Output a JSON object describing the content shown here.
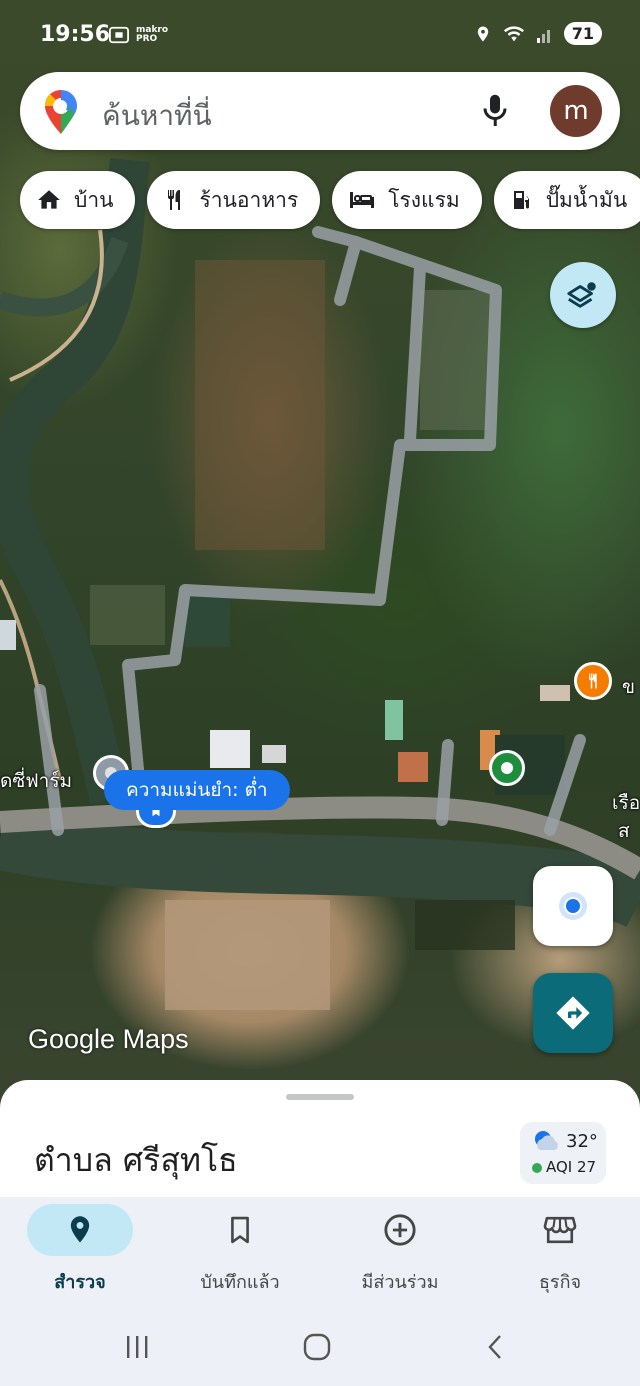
{
  "status_bar": {
    "time": "19:56",
    "notification_icons": [
      "screenshot-icon",
      "makro-pro-icon"
    ],
    "notif_text": "makro PRO",
    "battery": "71"
  },
  "search": {
    "placeholder": "ค้นหาที่นี่",
    "avatar_letter": "m"
  },
  "chips": [
    {
      "label": "บ้าน",
      "icon": "home-icon"
    },
    {
      "label": "ร้านอาหาร",
      "icon": "restaurant-icon"
    },
    {
      "label": "โรงแรม",
      "icon": "hotel-icon"
    },
    {
      "label": "ปั๊มน้ำมัน",
      "icon": "gas-station-icon"
    }
  ],
  "map": {
    "accuracy_label": "ความแม่นยำ: ต่ำ",
    "place_label_left": "ดซี่ฟาร์ม",
    "place_label_right_1": "ข",
    "place_label_right_2": "เรือ",
    "place_label_right_3": "ส",
    "watermark": "Google Maps",
    "colors": {
      "restaurant_pin": "#f57c00",
      "green_pin": "#1e8e3e",
      "route": "#9aa0a6",
      "accuracy_blue": "#1a73e8"
    }
  },
  "sheet": {
    "title": "ตำบล ศรีสุทโธ",
    "temperature": "32°",
    "aqi": "AQI 27"
  },
  "nav": {
    "items": [
      {
        "label": "สำรวจ",
        "icon": "explore-pin-icon",
        "active": true
      },
      {
        "label": "บันทึกแล้ว",
        "icon": "bookmark-icon",
        "active": false
      },
      {
        "label": "มีส่วนร่วม",
        "icon": "add-circle-icon",
        "active": false
      },
      {
        "label": "ธุรกิจ",
        "icon": "storefront-icon",
        "active": false
      }
    ]
  }
}
